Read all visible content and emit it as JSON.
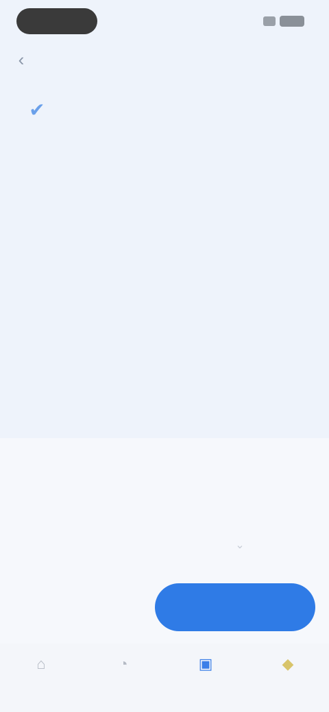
{
  "header": {
    "title": "",
    "back_icon": "chevron-left-icon"
  },
  "hero": {
    "icon": "ballot-icon"
  },
  "page": {
    "title": "",
    "paragraphs": [
      "",
      "",
      ""
    ]
  },
  "vote": {
    "option_left": "",
    "option_right": "",
    "primary_button": "",
    "secondary_link": ""
  },
  "tabs": [
    {
      "label": "",
      "icon": "home-icon"
    },
    {
      "label": "",
      "icon": "chat-icon"
    },
    {
      "label": "",
      "icon": "vote-icon"
    },
    {
      "label": "",
      "icon": "bell-icon"
    }
  ],
  "colors": {
    "accent": "#2f7be6",
    "background": "#eef3fb"
  }
}
